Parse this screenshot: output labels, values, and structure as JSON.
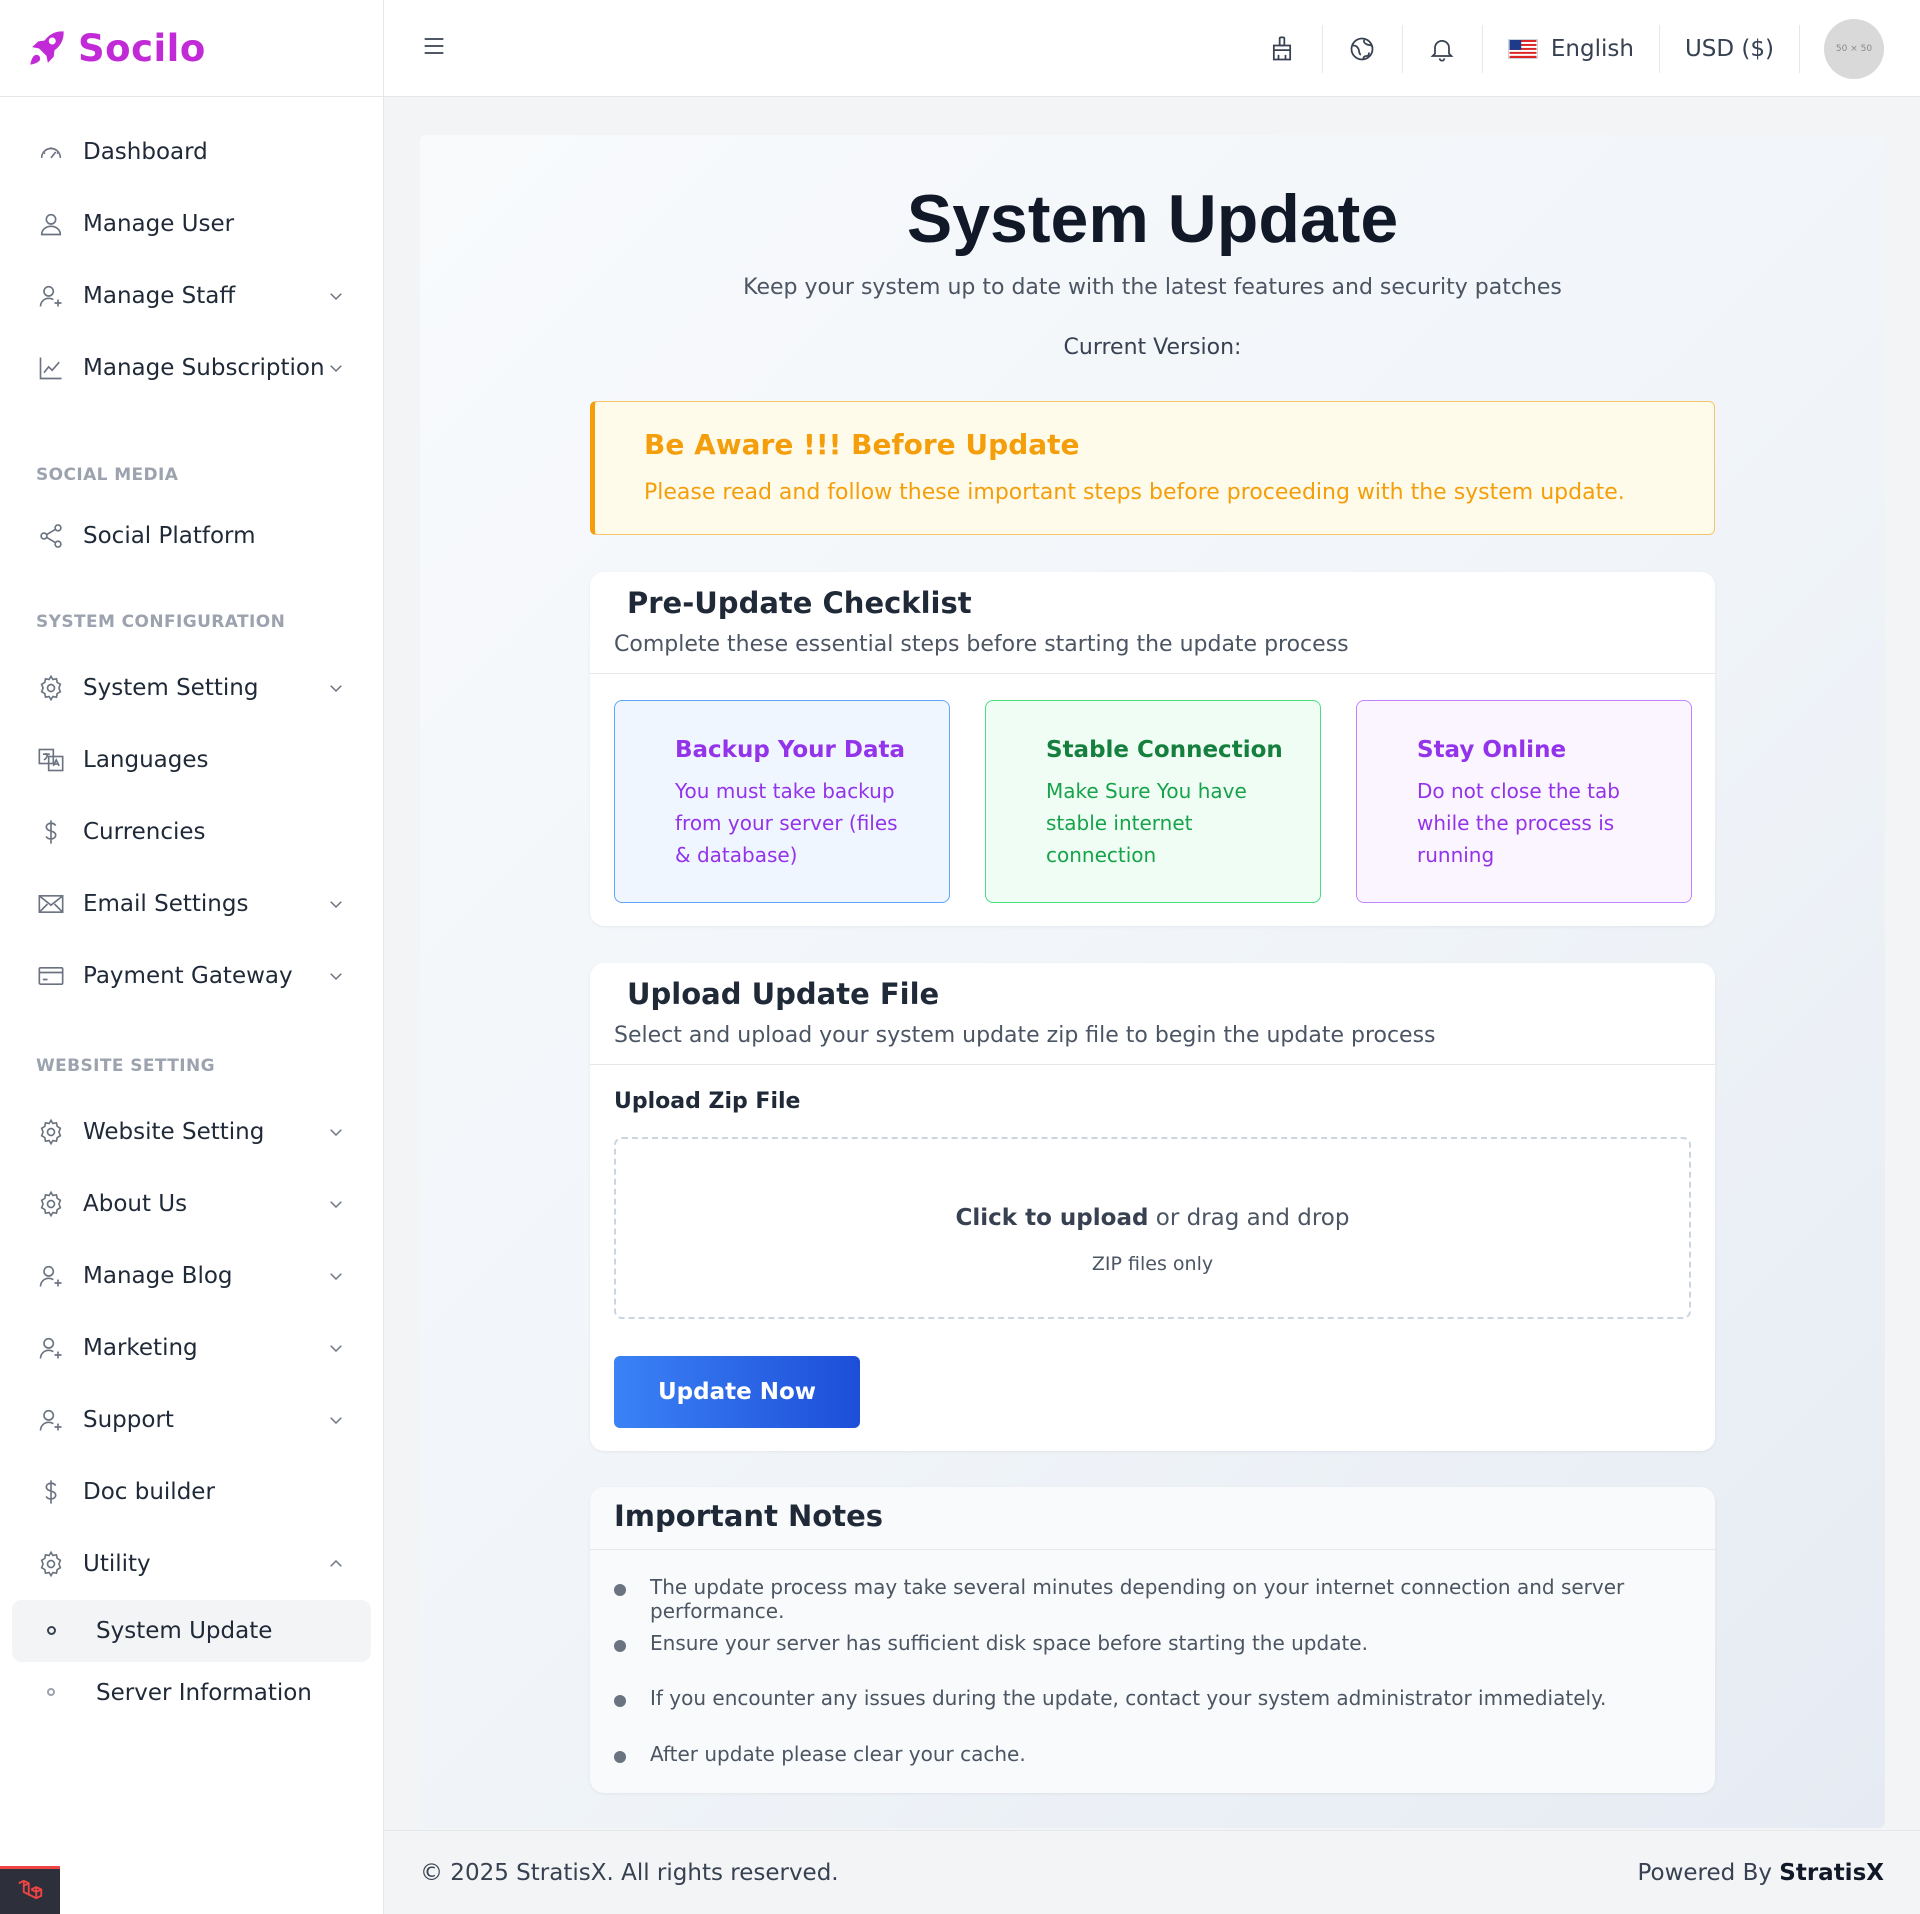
{
  "brand": {
    "name": "Socilo",
    "color": "#c12ad6"
  },
  "sidebar": {
    "items": [
      {
        "label": "Dashboard"
      },
      {
        "label": "Manage User"
      },
      {
        "label": "Manage Staff"
      },
      {
        "label": "Manage Subscription"
      }
    ],
    "section_social": "SOCIAL MEDIA",
    "social_items": [
      {
        "label": "Social Platform"
      }
    ],
    "section_system": "SYSTEM CONFIGURATION",
    "system_items": [
      {
        "label": "System Setting"
      },
      {
        "label": "Languages"
      },
      {
        "label": "Currencies"
      },
      {
        "label": "Email Settings"
      },
      {
        "label": "Payment Gateway"
      }
    ],
    "section_website": "WEBSITE SETTING",
    "website_items": [
      {
        "label": "Website Setting"
      },
      {
        "label": "About Us"
      },
      {
        "label": "Manage Blog"
      },
      {
        "label": "Marketing"
      },
      {
        "label": "Support"
      },
      {
        "label": "Doc builder"
      },
      {
        "label": "Utility"
      }
    ],
    "utility_sub": [
      {
        "label": "System Update"
      },
      {
        "label": "Server Information"
      }
    ]
  },
  "header": {
    "language": "English",
    "currency": "USD ($)",
    "avatar_text": "50 × 50"
  },
  "page": {
    "title": "System Update",
    "subtitle": "Keep your system up to date with the latest features and security patches",
    "version_label": "Current Version:"
  },
  "alert": {
    "title": "Be Aware !!! Before Update",
    "text": "Please read and follow these important steps before proceeding with the system update."
  },
  "checklist": {
    "title": "Pre-Update Checklist",
    "desc": "Complete these essential steps before starting the update process",
    "items": [
      {
        "title": "Backup Your Data",
        "text": "You must take backup from your server (files & database)"
      },
      {
        "title": "Stable Connection",
        "text": "Make Sure You have stable internet connection"
      },
      {
        "title": "Stay Online",
        "text": "Do not close the tab while the process is running"
      }
    ]
  },
  "upload": {
    "title": "Upload Update File",
    "desc": "Select and upload your system update zip file to begin the update process",
    "label": "Upload Zip File",
    "click_text": "Click to upload",
    "drag_text": " or drag and drop",
    "hint": "ZIP files only",
    "button": "Update Now"
  },
  "notes": {
    "title": "Important Notes",
    "items": [
      "The update process may take several minutes depending on your internet connection and server performance.",
      "Ensure your server has sufficient disk space before starting the update.",
      "If you encounter any issues during the update, contact your system administrator immediately.",
      "After update please clear your cache."
    ]
  },
  "footer": {
    "copyright": "© 2025 StratisX. All rights reserved.",
    "powered_prefix": "Powered By ",
    "powered_brand": "StratisX"
  }
}
